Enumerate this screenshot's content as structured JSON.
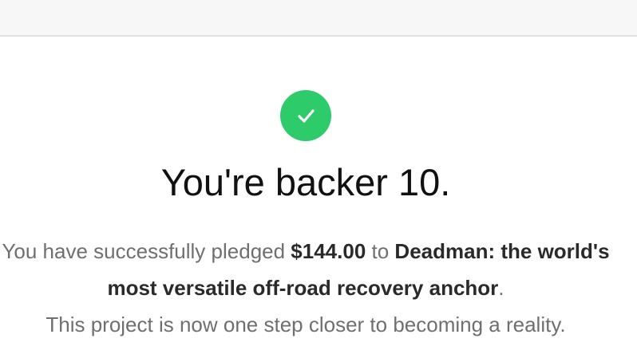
{
  "header": {},
  "confirmation": {
    "icon": "checkmark-icon",
    "icon_color": "#2ecb6b",
    "headline": "You're backer 10.",
    "message_prefix": "You have successfully pledged ",
    "amount": "$144.00",
    "message_to": " to ",
    "project_name": "Deadman: the world's most versatile off-road recovery anchor",
    "message_period": ".",
    "message_suffix": "This project is now one step closer to becoming a reality."
  }
}
